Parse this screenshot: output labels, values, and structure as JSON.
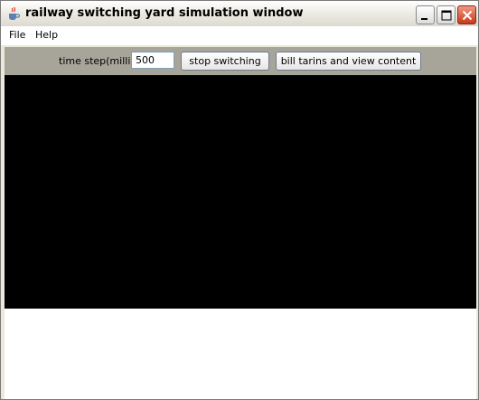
{
  "window": {
    "title": "railway switching yard simulation window",
    "icon": "java-cup-icon",
    "controls": [
      "minimize-icon",
      "maximize-icon",
      "close-icon"
    ]
  },
  "menu": {
    "items": [
      {
        "label": "File"
      },
      {
        "label": "Help"
      }
    ]
  },
  "toolbar": {
    "time_step_label": "time step(millis)",
    "time_step_value": "500",
    "stop_button": "stop switching",
    "bill_button": "bill tarins and view content"
  },
  "colors": {
    "canvas": "#000000",
    "toolbar": "#a7a59a",
    "close_button": "#d9432c"
  }
}
